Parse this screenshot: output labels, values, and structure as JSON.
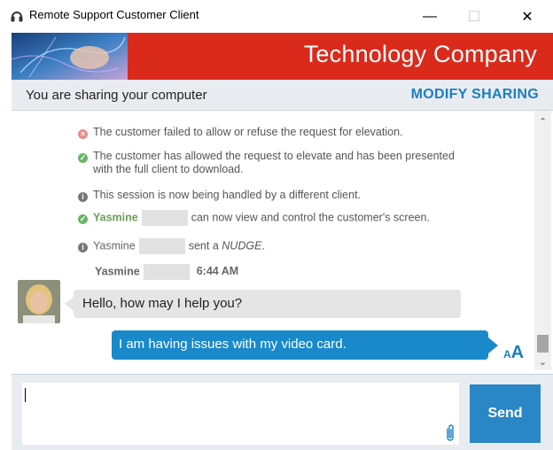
{
  "window": {
    "title": "Remote Support Customer Client",
    "minimize": "—",
    "maximize": "☐",
    "close": "✕"
  },
  "banner": {
    "company": "Technology Company"
  },
  "sharing": {
    "status": "You are sharing your computer",
    "modify_label": "MODIFY SHARING"
  },
  "events": [
    {
      "icon": "error",
      "text": "The customer failed to allow or refuse the request for elevation."
    },
    {
      "icon": "success",
      "text": "The customer has allowed the request to elevate and has been presented with the full client to download."
    },
    {
      "icon": "info",
      "text": "This session is now being handled by a different client."
    },
    {
      "icon": "success",
      "agent": "Yasmine",
      "text": "can now view and control the customer's screen."
    },
    {
      "icon": "info",
      "agent": "Yasmine",
      "text_before": "sent a",
      "nudge": "NUDGE",
      "text_after": "."
    }
  ],
  "messages": {
    "agent_name": "Yasmine",
    "time": "6:44 AM",
    "incoming": "Hello, how may I help you?",
    "outgoing": "I am having issues with my video card."
  },
  "font_size_toggle": {
    "small": "A",
    "big": "A"
  },
  "composer": {
    "value": "",
    "send_label": "Send"
  },
  "colors": {
    "banner": "#da2a1c",
    "accent": "#1a7fc0",
    "outgoing_bubble": "#1a89cc",
    "incoming_bubble": "#e5e5e5",
    "send_button": "#2b86c5"
  }
}
